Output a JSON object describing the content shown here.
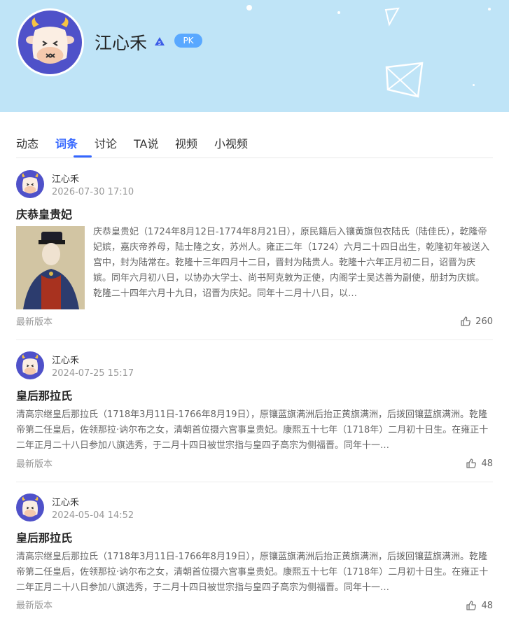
{
  "profile": {
    "name": "江心禾",
    "badge": "PK",
    "level_icon": "level-badge-icon"
  },
  "tabs": [
    "动态",
    "词条",
    "讨论",
    "TA说",
    "视频",
    "小视频"
  ],
  "active_tab_index": 1,
  "posts": [
    {
      "author": "江心禾",
      "date": "2026-07-30 17:10",
      "title": "庆恭皇贵妃",
      "summary": "庆恭皇贵妃（1724年8月12日-1774年8月21日），原民籍后入镶黄旗包衣陆氏（陆佳氏），乾隆帝妃嫔，嘉庆帝养母，陆士隆之女，苏州人。雍正二年（1724）六月二十四日出生，乾隆初年被送入宫中，封为陆常在。乾隆十三年四月十二日，晋封为陆贵人。乾隆十六年正月初二日，诏晋为庆嫔。同年六月初八日，以协办大学士、尚书阿克敦为正使，内阁学士吴达善为副使，册封为庆嫔。乾隆二十四年六月十九日，诏晋为庆妃。同年十二月十八日，以…",
      "version": "最新版本",
      "likes": "260"
    },
    {
      "author": "江心禾",
      "date": "2024-07-25 15:17",
      "title": "皇后那拉氏",
      "summary": "清高宗继皇后那拉氏（1718年3月11日-1766年8月19日），原镶蓝旗满洲后抬正黄旗满洲，后拨回镶蓝旗满洲。乾隆帝第二任皇后，佐领那拉·讷尔布之女，清朝首位摄六宫事皇贵妃。康熙五十七年（1718年）二月初十日生。在雍正十二年正月二十八日参加八旗选秀，于二月十四日被世宗指与皇四子高宗为侧福晋。同年十一…",
      "version": "最新版本",
      "likes": "48"
    },
    {
      "author": "江心禾",
      "date": "2024-05-04 14:52",
      "title": "皇后那拉氏",
      "summary": "清高宗继皇后那拉氏（1718年3月11日-1766年8月19日），原镶蓝旗满洲后抬正黄旗满洲，后拨回镶蓝旗满洲。乾隆帝第二任皇后，佐领那拉·讷尔布之女，清朝首位摄六宫事皇贵妃。康熙五十七年（1718年）二月初十日生。在雍正十二年正月二十八日参加八旗选秀，于二月十四日被世宗指与皇四子高宗为侧福晋。同年十一…",
      "version": "最新版本",
      "likes": "48"
    }
  ],
  "colors": {
    "banner": "#bfe4f7",
    "accent": "#3466ff",
    "avatar_bg": "#4f51c9",
    "pk_badge": "#59a8ff"
  }
}
